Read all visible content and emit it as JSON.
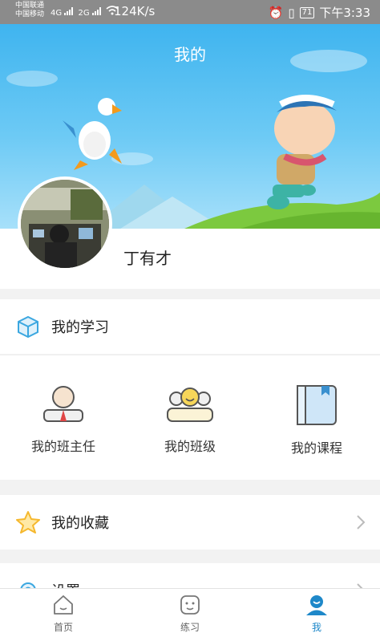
{
  "status_bar": {
    "carrier_1": "中国联通",
    "carrier_2": "中国移动",
    "network_1": "4G",
    "network_2": "2G",
    "speed": "124K/s",
    "battery": "71",
    "time": "下午3:33"
  },
  "header": {
    "title": "我的"
  },
  "profile": {
    "name": "丁有才"
  },
  "my_study": {
    "label": "我的学习"
  },
  "grid": [
    {
      "label": "我的班主任",
      "icon": "teacher-icon"
    },
    {
      "label": "我的班级",
      "icon": "class-icon"
    },
    {
      "label": "我的课程",
      "icon": "book-icon"
    }
  ],
  "favorites": {
    "label": "我的收藏",
    "icon": "star-icon"
  },
  "settings": {
    "label": "设置",
    "icon": "gear-icon"
  },
  "tabs": [
    {
      "label": "首页",
      "icon": "home-icon",
      "active": false
    },
    {
      "label": "练习",
      "icon": "practice-icon",
      "active": false
    },
    {
      "label": "我",
      "icon": "user-icon",
      "active": true
    }
  ],
  "colors": {
    "accent": "#1e88c9",
    "banner": "#3fb4ef",
    "star": "#f5b82e"
  }
}
